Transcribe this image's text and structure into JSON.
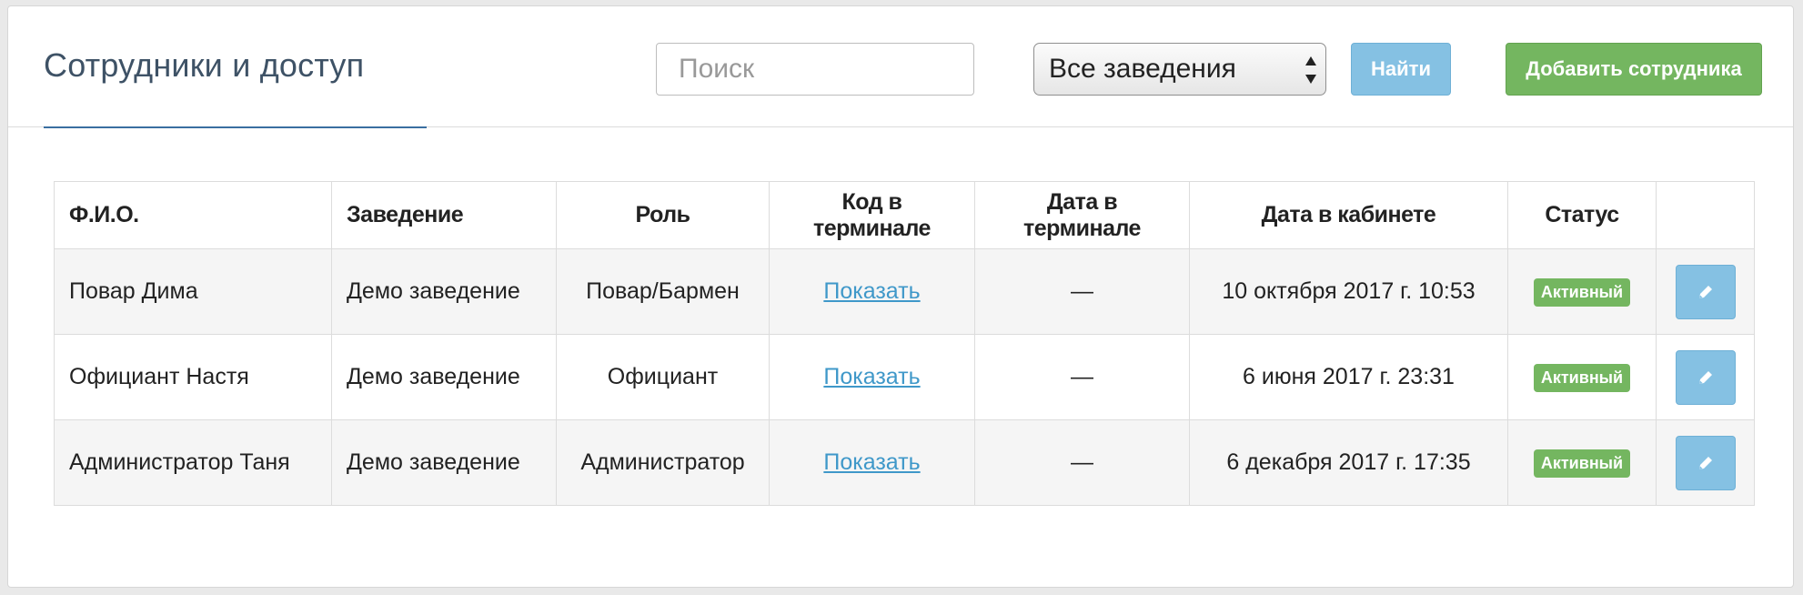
{
  "header": {
    "title": "Сотрудники и доступ",
    "search_placeholder": "Поиск",
    "venue_select_value": "Все заведения",
    "find_label": "Найти",
    "add_label": "Добавить сотрудника"
  },
  "table": {
    "columns": [
      "Ф.И.О.",
      "Заведение",
      "Роль",
      "Код в терминале",
      "Дата в терминале",
      "Дата в кабинете",
      "Статус",
      ""
    ],
    "rows": [
      {
        "name": "Повар Дима",
        "venue": "Демо заведение",
        "role": "Повар/Бармен",
        "code": "Показать",
        "terminal_date": "—",
        "cabinet_date": "10 октября 2017 г. 10:53",
        "status": "Активный"
      },
      {
        "name": "Официант Настя",
        "venue": "Демо заведение",
        "role": "Официант",
        "code": "Показать",
        "terminal_date": "—",
        "cabinet_date": "6 июня 2017 г. 23:31",
        "status": "Активный"
      },
      {
        "name": "Администратор Таня",
        "venue": "Демо заведение",
        "role": "Администратор",
        "code": "Показать",
        "terminal_date": "—",
        "cabinet_date": "6 декабря 2017 г. 17:35",
        "status": "Активный"
      }
    ]
  },
  "icons": {
    "edit": "pencil-icon",
    "select": "select-arrows-icon"
  },
  "colors": {
    "primary": "#85c1e3",
    "success": "#74b660",
    "title": "#3e5266",
    "link": "#3f98c9"
  }
}
